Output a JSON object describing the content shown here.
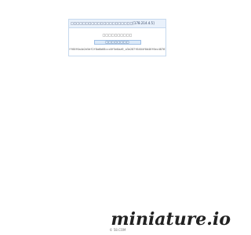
{
  "notice": {
    "header_text": "□□□□□□□□□□□□□□□□□□□□□[178.214.4.5]",
    "message": "□□□□□□□□□□",
    "button_label": "□□□□□□□□",
    "token": "ff66f6a4e2e5df2f8a6b68ccc0f5e0aa9_a3e287f6404f0d46f6ec4876373b8ec3"
  },
  "footer": {
    "copyright": "© 58.COM"
  },
  "watermark": {
    "text": "miniature.io"
  }
}
